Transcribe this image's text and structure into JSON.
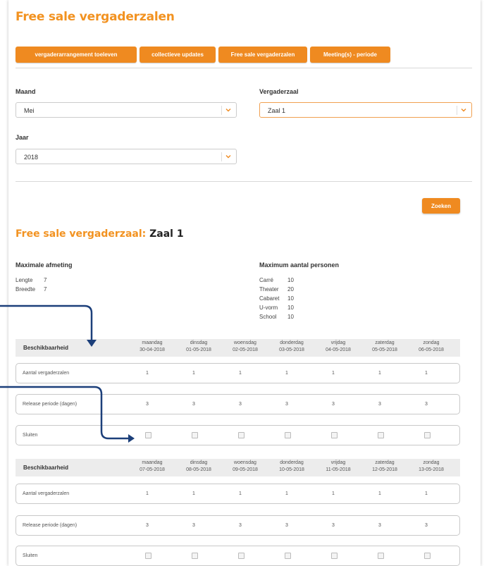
{
  "page": {
    "title": "Free sale vergaderzalen"
  },
  "tabs": [
    {
      "label": "vergaderarrangement toeleven"
    },
    {
      "label": "collectieve updates"
    },
    {
      "label": "Free sale vergaderzalen"
    },
    {
      "label": "Meeting(s) - periode"
    }
  ],
  "filters": {
    "maand": {
      "label": "Maand",
      "value": "Mei"
    },
    "vergaderzaal": {
      "label": "Vergaderzaal",
      "value": "Zaal 1"
    },
    "jaar": {
      "label": "Jaar",
      "value": "2018"
    },
    "search_label": "Zoeken"
  },
  "room": {
    "heading_prefix": "Free sale vergaderzaal:",
    "heading_name": "Zaal 1",
    "size_title": "Maximale afmeting",
    "sizes": [
      {
        "k": "Lengte",
        "v": "7"
      },
      {
        "k": "Breedte",
        "v": "7"
      }
    ],
    "persons_title": "Maximum aantal personen",
    "persons": [
      {
        "k": "Carré",
        "v": "10"
      },
      {
        "k": "Theater",
        "v": "20"
      },
      {
        "k": "Cabaret",
        "v": "10"
      },
      {
        "k": "U-vorm",
        "v": "10"
      },
      {
        "k": "School",
        "v": "10"
      }
    ]
  },
  "weeks": [
    {
      "header_label": "Beschikbaarheid",
      "days": [
        {
          "name": "maandag",
          "date": "30-04-2018"
        },
        {
          "name": "dinsdag",
          "date": "01-05-2018"
        },
        {
          "name": "woensdag",
          "date": "02-05-2018"
        },
        {
          "name": "donderdag",
          "date": "03-05-2018"
        },
        {
          "name": "vrijdag",
          "date": "04-05-2018"
        },
        {
          "name": "zaterdag",
          "date": "05-05-2018"
        },
        {
          "name": "zondag",
          "date": "06-05-2018"
        }
      ],
      "rows": [
        {
          "label": "Aantal vergaderzalen",
          "values": [
            "1",
            "1",
            "1",
            "1",
            "1",
            "1",
            "1"
          ]
        },
        {
          "label": "Release periode (dagen)",
          "values": [
            "3",
            "3",
            "3",
            "3",
            "3",
            "3",
            "3"
          ]
        }
      ],
      "close_label": "Sluiten"
    },
    {
      "header_label": "Beschikbaarheid",
      "days": [
        {
          "name": "maandag",
          "date": "07-05-2018"
        },
        {
          "name": "dinsdag",
          "date": "08-05-2018"
        },
        {
          "name": "woensdag",
          "date": "09-05-2018"
        },
        {
          "name": "donderdag",
          "date": "10-05-2018"
        },
        {
          "name": "vrijdag",
          "date": "11-05-2018"
        },
        {
          "name": "zaterdag",
          "date": "12-05-2018"
        },
        {
          "name": "zondag",
          "date": "13-05-2018"
        }
      ],
      "rows": [
        {
          "label": "Aantal vergaderzalen",
          "values": [
            "1",
            "1",
            "1",
            "1",
            "1",
            "1",
            "1"
          ]
        },
        {
          "label": "Release periode (dagen)",
          "values": [
            "3",
            "3",
            "3",
            "3",
            "3",
            "3",
            "3"
          ]
        }
      ],
      "close_label": "Sluiten"
    }
  ],
  "colors": {
    "accent": "#ef8a20",
    "annotation_arrow": "#1c3f7a"
  }
}
